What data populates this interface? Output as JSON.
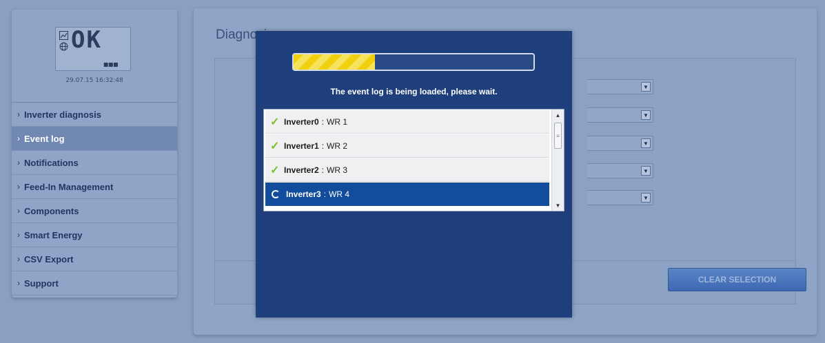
{
  "device": {
    "display_text": "OK",
    "datetime": "29.07.15 16:32:48",
    "dots": "▪▪▪"
  },
  "sidebar": {
    "items": [
      {
        "label": "Inverter diagnosis",
        "active": false
      },
      {
        "label": "Event log",
        "active": true
      },
      {
        "label": "Notifications",
        "active": false
      },
      {
        "label": "Feed-In Management",
        "active": false
      },
      {
        "label": "Components",
        "active": false
      },
      {
        "label": "Smart Energy",
        "active": false
      },
      {
        "label": "CSV Export",
        "active": false
      },
      {
        "label": "Support",
        "active": false
      }
    ]
  },
  "main": {
    "title": "Diagnosis",
    "clear_button": "CLEAR SELECTION"
  },
  "modal": {
    "progress": 0.34,
    "message": "The event log is being loaded, please wait.",
    "items": [
      {
        "device": "Inverter0",
        "separator": ":",
        "name": "WR 1",
        "status": "done"
      },
      {
        "device": "Inverter1",
        "separator": ":",
        "name": "WR 2",
        "status": "done"
      },
      {
        "device": "Inverter2",
        "separator": ":",
        "name": "WR 3",
        "status": "done"
      },
      {
        "device": "Inverter3",
        "separator": ":",
        "name": "WR 4",
        "status": "loading"
      }
    ]
  },
  "icons": {
    "check": "✓",
    "chevron": "›",
    "arrow_down": "▼",
    "arrow_up": "▲",
    "grip": "≡"
  },
  "colors": {
    "modal_bg": "#1f3f7c",
    "progress": "#f1d10f",
    "check": "#78c42a",
    "selection": "#114d9c"
  }
}
